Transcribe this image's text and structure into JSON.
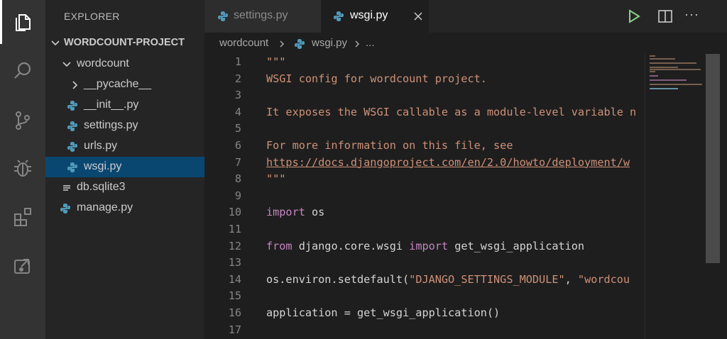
{
  "activity_bar": {
    "items": [
      "explorer-icon",
      "search-icon",
      "source-control-icon",
      "debug-icon",
      "extensions-icon",
      "remote-explorer-icon"
    ]
  },
  "sidebar": {
    "title": "EXPLORER",
    "project": "WORDCOUNT-PROJECT",
    "tree": [
      {
        "label": "wordcount",
        "type": "folder-open"
      },
      {
        "label": "__pycache__",
        "type": "folder-closed"
      },
      {
        "label": "__init__.py",
        "type": "python"
      },
      {
        "label": "settings.py",
        "type": "python"
      },
      {
        "label": "urls.py",
        "type": "python"
      },
      {
        "label": "wsgi.py",
        "type": "python",
        "selected": true
      },
      {
        "label": "db.sqlite3",
        "type": "file"
      },
      {
        "label": "manage.py",
        "type": "python"
      }
    ]
  },
  "tabs": [
    {
      "label": "settings.py",
      "active": false
    },
    {
      "label": "wsgi.py",
      "active": true
    }
  ],
  "toolbar": {
    "run": "run-icon",
    "split": "split-editor-icon",
    "more": "···"
  },
  "breadcrumb": [
    "wordcount",
    "wsgi.py",
    "..."
  ],
  "editor": {
    "line_numbers": [
      "1",
      "2",
      "3",
      "4",
      "5",
      "6",
      "7",
      "8",
      "9",
      "10",
      "11",
      "12",
      "13",
      "14",
      "15",
      "16",
      "17"
    ],
    "lines": {
      "l1": "\"\"\"",
      "l2": "WSGI config for wordcount project.",
      "l4": "It exposes the WSGI callable as a module-level variable n",
      "l6": "For more information on this file, see",
      "l7": "https://docs.djangoproject.com/en/2.0/howto/deployment/w",
      "l8": "\"\"\"",
      "l10_kw": "import",
      "l10_rest": " os",
      "l12_kw1": "from",
      "l12_mid": " django.core.wsgi ",
      "l12_kw2": "import",
      "l12_rest": " get_wsgi_application",
      "l14_pre": "os.environ.setdefault(",
      "l14_s1": "\"DJANGO_SETTINGS_MODULE\"",
      "l14_comma": ", ",
      "l14_s2": "\"wordcou",
      "l16": "application = get_wsgi_application()"
    }
  },
  "colors": {
    "string": "#ce9178",
    "keyword": "#c586c0",
    "selection": "#094771",
    "run": "#89d185"
  }
}
